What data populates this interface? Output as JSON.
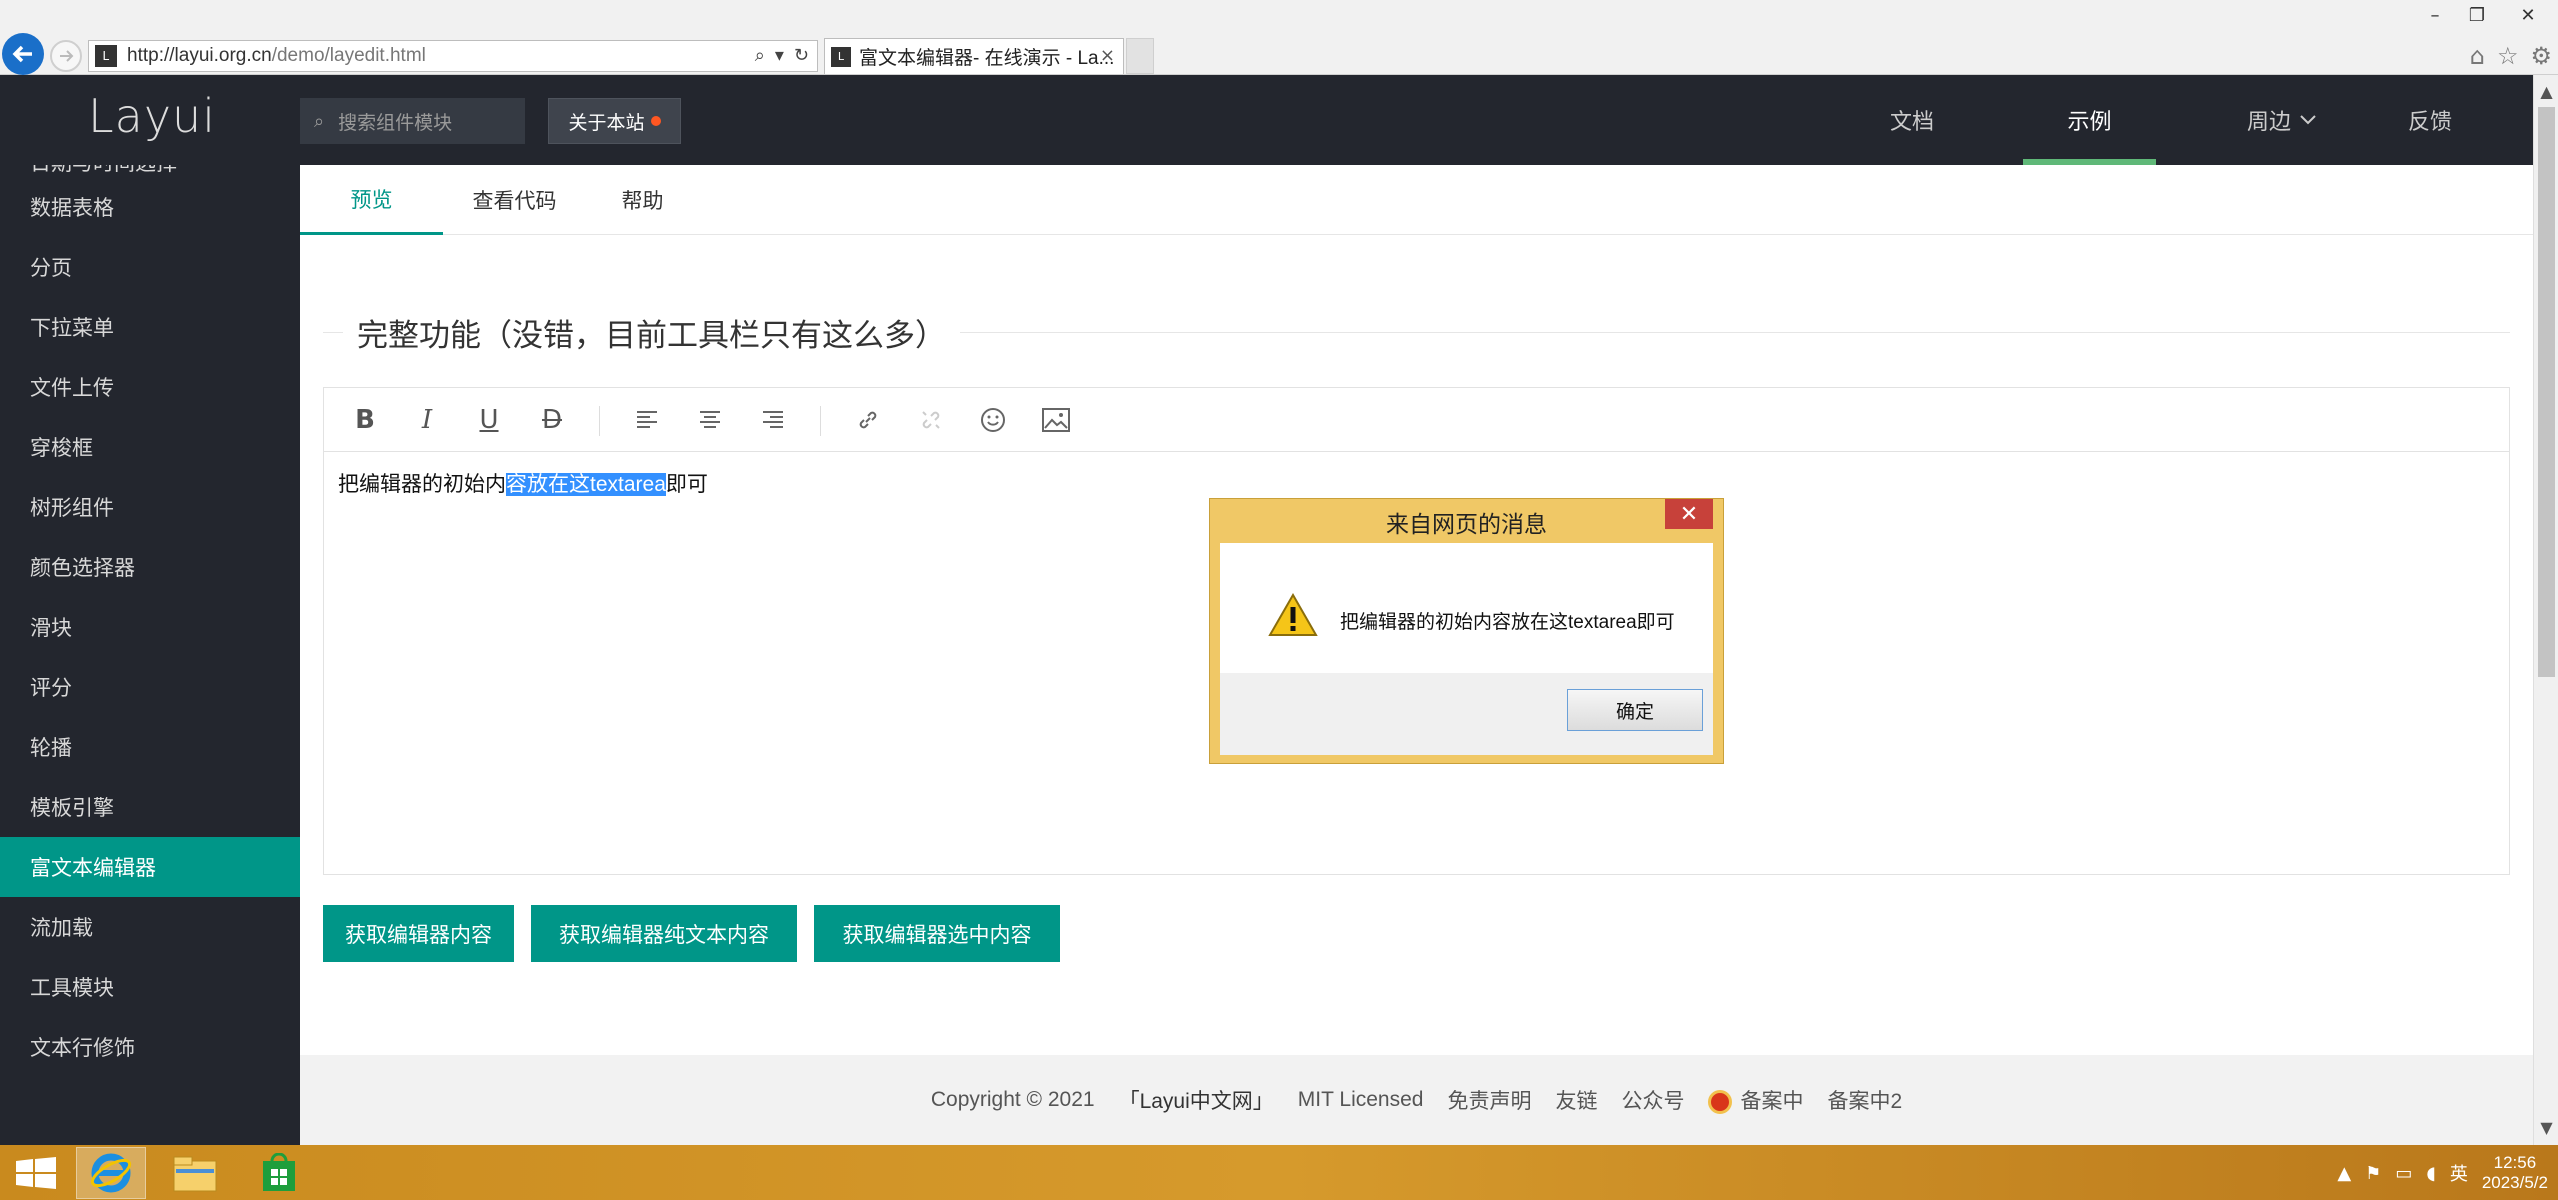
{
  "browser": {
    "url_host": "http://layui.org.cn",
    "url_path": "/demo/layedit.html",
    "tab_title": "富文本编辑器- 在线演示 - La...",
    "tab_close": "×"
  },
  "header": {
    "logo": "Layui",
    "search_placeholder": "搜索组件模块",
    "about_label": "关于本站",
    "nav": [
      {
        "label": "文档"
      },
      {
        "label": "示例"
      },
      {
        "label": "周边"
      },
      {
        "label": "反馈"
      }
    ]
  },
  "sidebar": {
    "partial_item": "日期与时间选择",
    "items": [
      {
        "label": "数据表格"
      },
      {
        "label": "分页"
      },
      {
        "label": "下拉菜单"
      },
      {
        "label": "文件上传"
      },
      {
        "label": "穿梭框"
      },
      {
        "label": "树形组件"
      },
      {
        "label": "颜色选择器"
      },
      {
        "label": "滑块"
      },
      {
        "label": "评分"
      },
      {
        "label": "轮播"
      },
      {
        "label": "模板引擎"
      },
      {
        "label": "富文本编辑器"
      },
      {
        "label": "流加载"
      },
      {
        "label": "工具模块"
      },
      {
        "label": "文本行修饰"
      }
    ],
    "active_index": 11
  },
  "tabs": [
    {
      "label": "预览"
    },
    {
      "label": "查看代码"
    },
    {
      "label": "帮助"
    }
  ],
  "section_title": "完整功能（没错，目前工具栏只有这么多）",
  "editor": {
    "text_before": "把编辑器的初始内",
    "text_selected": "容放在这textarea",
    "text_after": "即可"
  },
  "buttons": [
    {
      "label": "获取编辑器内容"
    },
    {
      "label": "获取编辑器纯文本内容"
    },
    {
      "label": "获取编辑器选中内容"
    }
  ],
  "footer": {
    "copyright": "Copyright © 2021",
    "brand": "「Layui中文网」",
    "license": "MIT Licensed",
    "links": [
      "免责声明",
      "友链",
      "公众号"
    ],
    "icp1": "备案中",
    "icp2": "备案中2"
  },
  "dialog": {
    "title": "来自网页的消息",
    "message": "把编辑器的初始内容放在这textarea即可",
    "ok_label": "确定"
  },
  "taskbar": {
    "ime": "英",
    "time": "12:56",
    "date": "2023/5/2"
  },
  "colors": {
    "brand_green": "#009688",
    "nav_active_bar": "#5fb878",
    "header_bg": "#23262e",
    "about_dot": "#ff5722"
  }
}
